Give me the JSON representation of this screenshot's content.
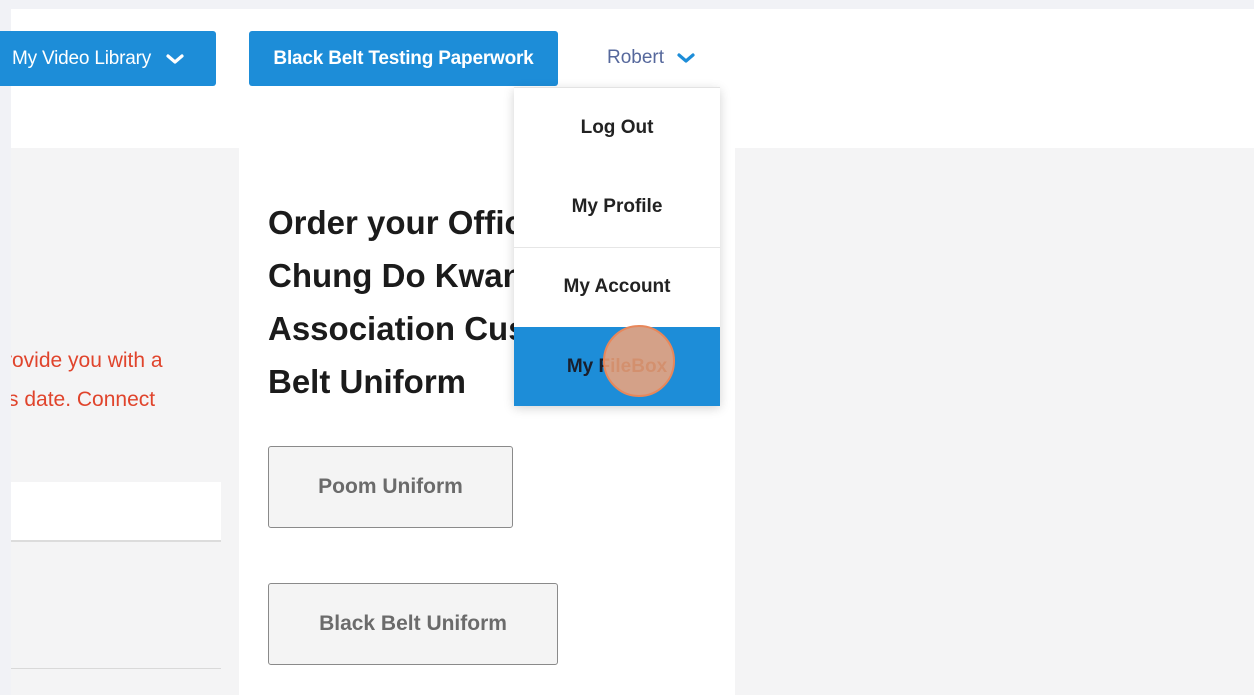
{
  "nav": {
    "video_library_label": "My Video Library",
    "testing_paperwork_label": "Black Belt Testing Paperwork",
    "user_name": "Robert"
  },
  "user_dropdown": {
    "items": [
      {
        "label": "Log Out"
      },
      {
        "label": "My Profile"
      },
      {
        "label": "My Account"
      },
      {
        "label": "My FileBox",
        "highlighted": true
      }
    ]
  },
  "main": {
    "heading_lines": [
      "Order your Offic",
      "Chung Do Kwan",
      "Association Cus",
      "Belt Uniform"
    ],
    "buttons": {
      "poom_label": "Poom Uniform",
      "black_belt_label": "Black Belt Uniform"
    }
  },
  "left_panel": {
    "notice_lines": [
      "rovide you with a",
      "s date. Connect"
    ]
  },
  "colors": {
    "accent_blue": "#1d8dd8",
    "notice_red": "#e0442c",
    "user_link": "#56689c",
    "click_marker": "#f4a57a"
  }
}
